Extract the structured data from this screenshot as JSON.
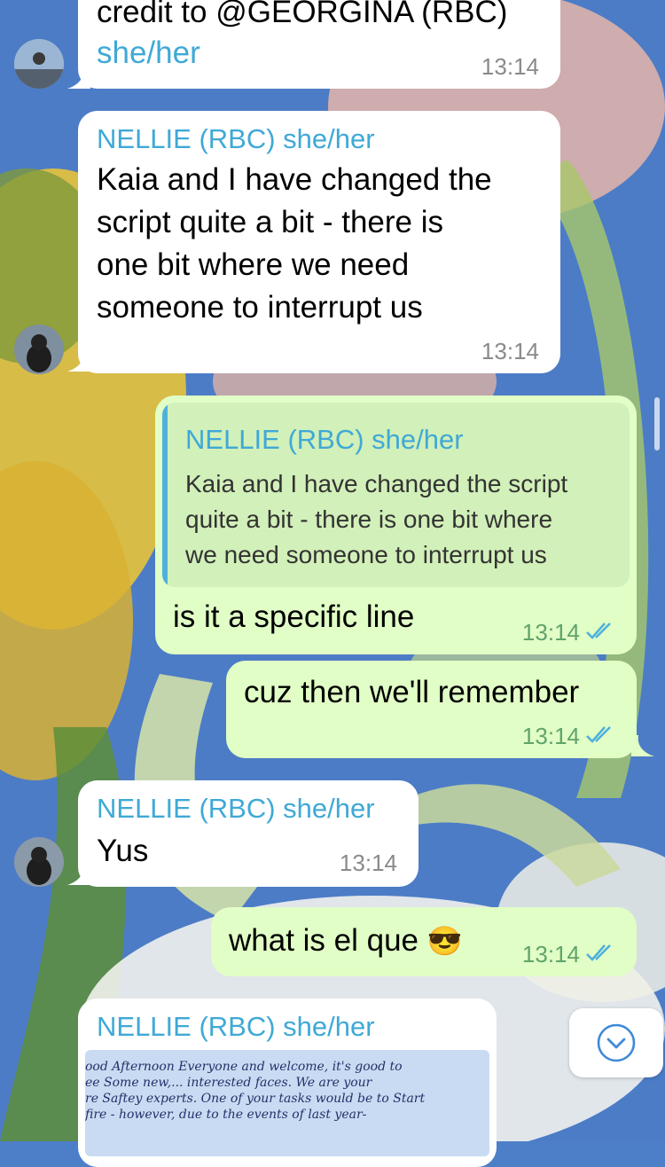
{
  "messages": [
    {
      "id": "m1",
      "dir": "in",
      "lines": [
        "credit to @GEORGINA (RBC)",
        "she/her"
      ],
      "time": "13:14"
    },
    {
      "id": "m2",
      "dir": "in",
      "sender": "NELLIE (RBC) she/her",
      "lines": [
        "Kaia and I have changed the",
        "script quite a bit - there is",
        "one bit where we need",
        "someone to interrupt us"
      ],
      "time": "13:14"
    },
    {
      "id": "m3",
      "dir": "out",
      "reply": {
        "sender": "NELLIE (RBC) she/her",
        "lines": [
          "Kaia and I have changed the script",
          "quite a bit - there is one bit where",
          "we need someone to interrupt us"
        ]
      },
      "text": "is it a specific line",
      "time": "13:14"
    },
    {
      "id": "m4",
      "dir": "out",
      "text": "cuz then we'll remember",
      "time": "13:14"
    },
    {
      "id": "m5",
      "dir": "in",
      "sender": "NELLIE (RBC) she/her",
      "text": "Yus",
      "time": "13:14"
    },
    {
      "id": "m6",
      "dir": "out",
      "text": "what is el que",
      "emoji": "😎",
      "time": "13:14"
    },
    {
      "id": "m7",
      "dir": "in",
      "sender": "NELLIE (RBC) she/her",
      "image_text": [
        "ood Afternoon Everyone and welcome, it's good to",
        "ee Some new,... interested faces. We are your",
        "re Saftey experts. One of your tasks would be to Start",
        "fire - however, due to the events of last year-"
      ]
    }
  ],
  "colors": {
    "incoming": "#ffffff",
    "outgoing": "#e1fec6",
    "sender": "#3fa9d6",
    "accent": "#4fb0dd"
  },
  "scroll_button": {
    "icon": "chevron-down-icon"
  }
}
